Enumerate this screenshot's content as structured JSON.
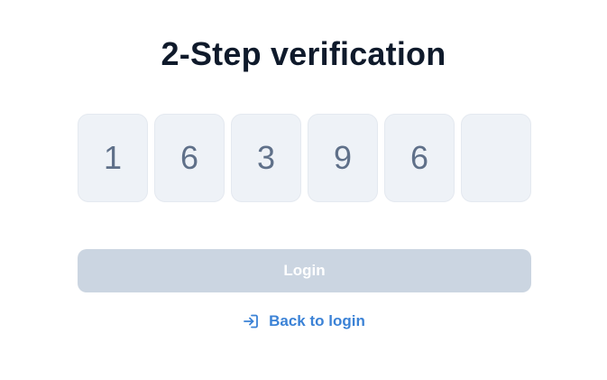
{
  "page": {
    "title": "2-Step verification"
  },
  "otp": {
    "digits": [
      "1",
      "6",
      "3",
      "9",
      "6",
      ""
    ]
  },
  "actions": {
    "login_label": "Login",
    "back_label": "Back to login"
  },
  "colors": {
    "title": "#0f1a2b",
    "otp_background": "#eef2f7",
    "otp_digit": "#5f7089",
    "login_disabled_background": "#cbd5e1",
    "link_accent": "#3b82d6"
  },
  "icons": {
    "back": "login-arrow-icon"
  }
}
